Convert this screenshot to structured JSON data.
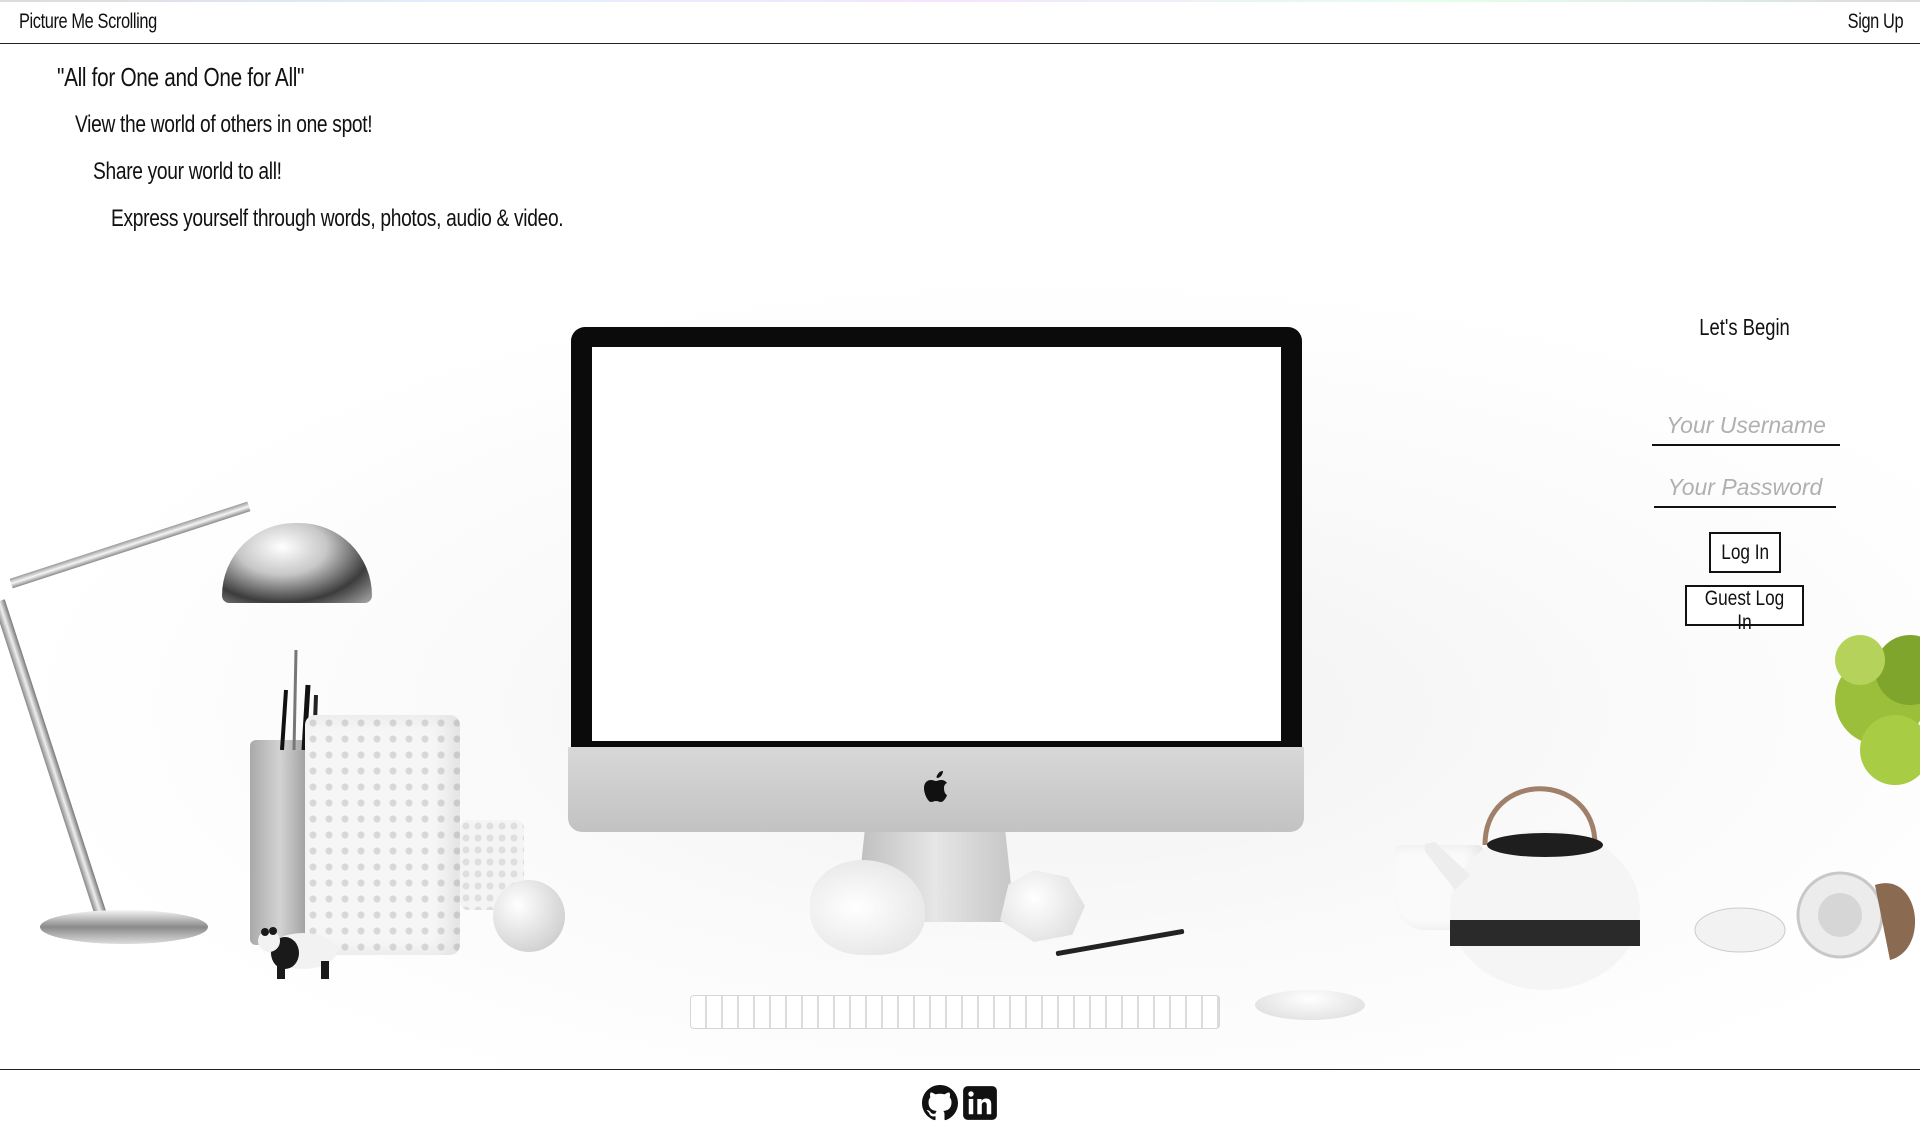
{
  "nav": {
    "brand": "Picture Me Scrolling",
    "signup_label": "Sign Up"
  },
  "taglines": [
    "\"All for One and One for All\"",
    "View the world of others in one spot!",
    "Share your world to all!",
    "Express yourself through words, photos, audio & video."
  ],
  "login": {
    "title": "Let's Begin",
    "username_placeholder": "Your Username",
    "password_placeholder": "Your Password",
    "login_label": "Log In",
    "guest_label": "Guest Log In"
  },
  "footer": {
    "icons": [
      "github-icon",
      "linkedin-icon"
    ]
  },
  "colors": {
    "text": "#111111",
    "background": "#ffffff",
    "placeholder": "#b0b0b0"
  }
}
